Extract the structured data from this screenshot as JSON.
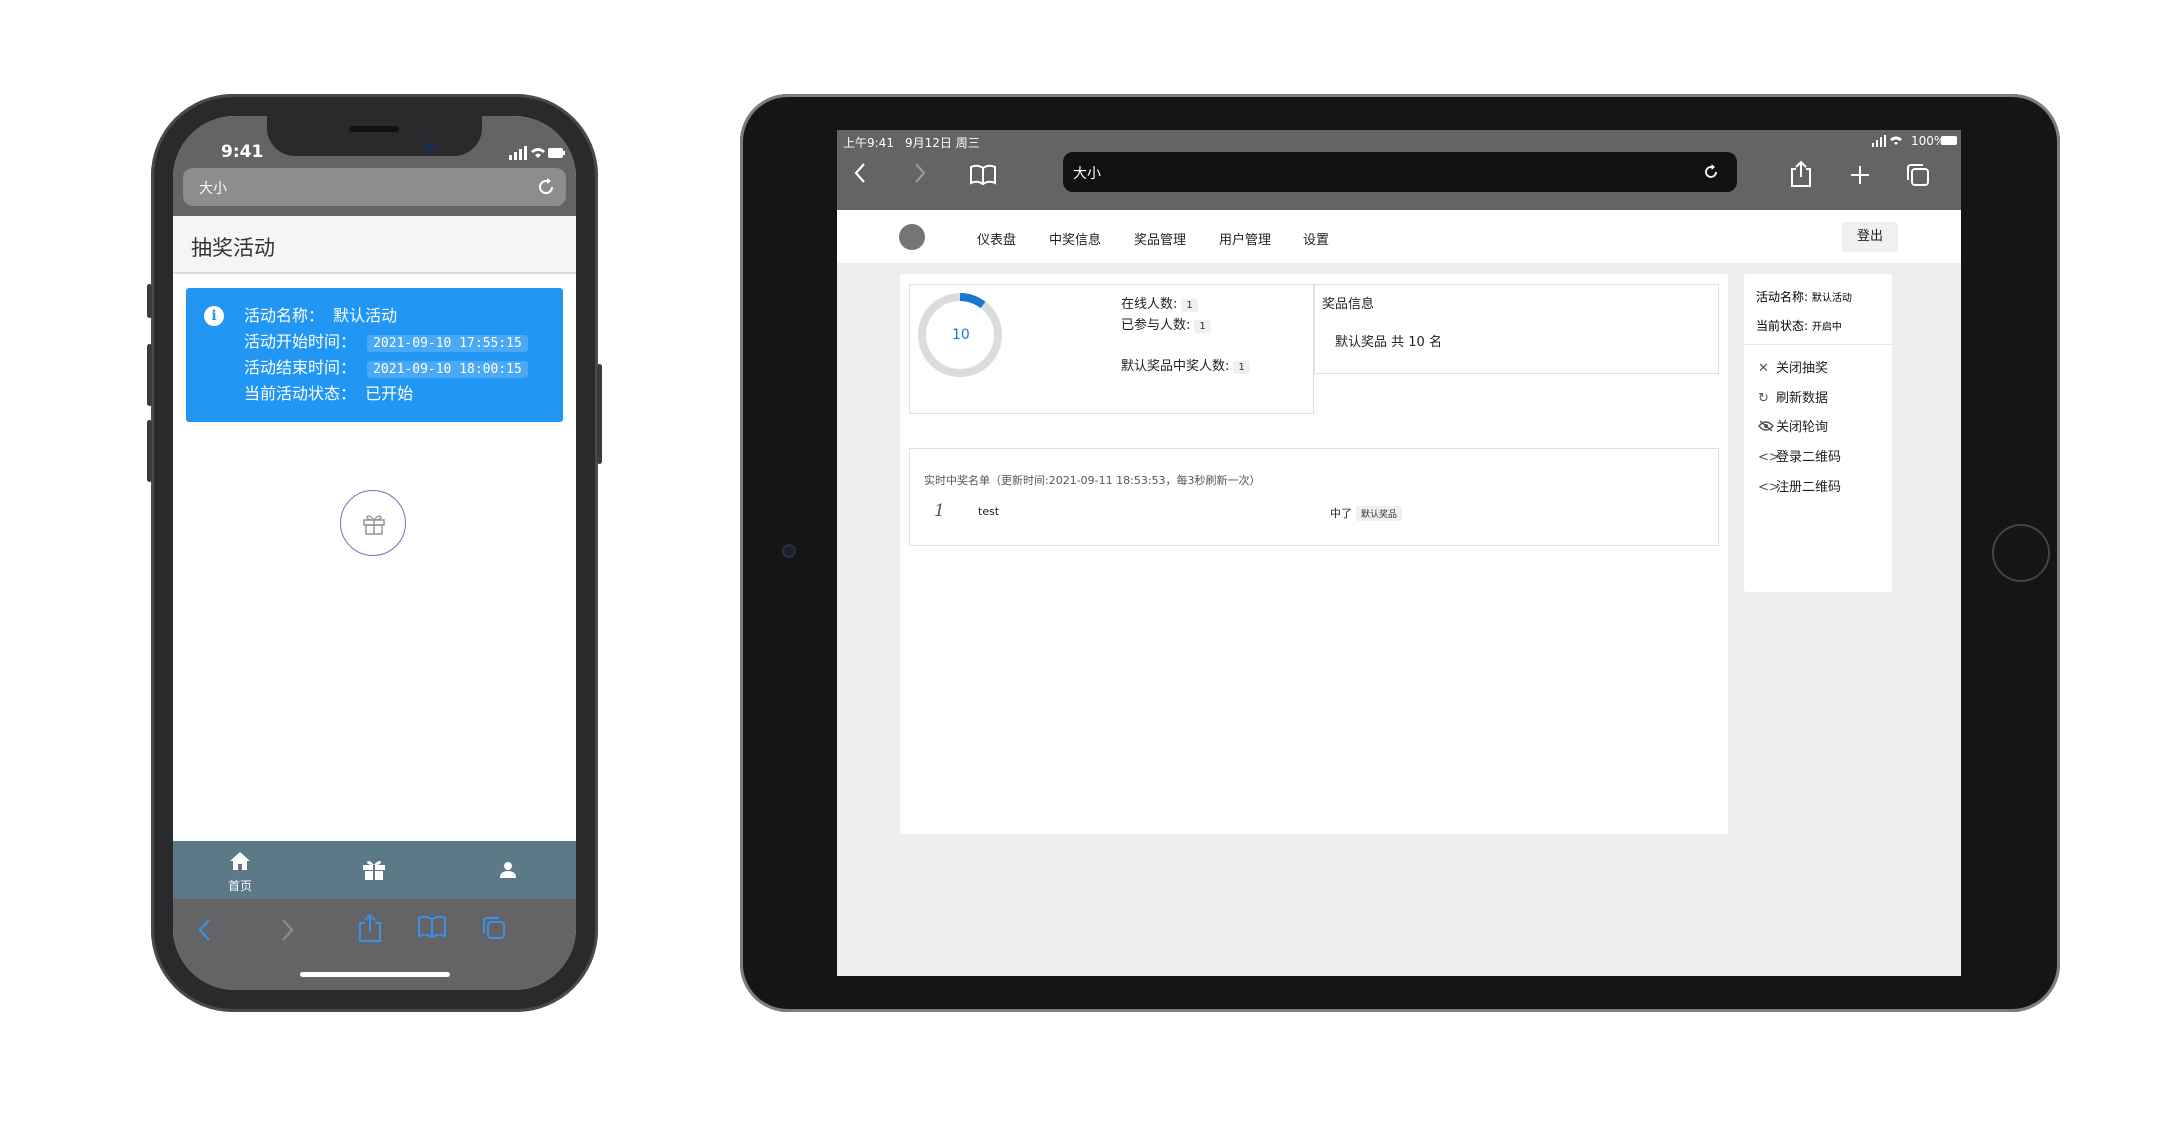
{
  "phone": {
    "status_time": "9:41",
    "url": "大小",
    "page_title": "抽奖活动",
    "info": {
      "icon": "info-icon",
      "name_label": "活动名称：",
      "name_value": "默认活动",
      "start_label": "活动开始时间：",
      "start_value": "2021-09-10 17:55:15",
      "end_label": "活动结束时间：",
      "end_value": "2021-09-10 18:00:15",
      "state_label": "当前活动状态：",
      "state_value": "已开始",
      "color": "#2196f3"
    },
    "tabs": [
      {
        "label": "首页",
        "icon": "home-icon"
      },
      {
        "label": "",
        "icon": "gift-icon"
      },
      {
        "label": "",
        "icon": "person-icon"
      }
    ],
    "tabbar_color": "#5b7987"
  },
  "tablet": {
    "status_time": "上午9:41",
    "status_date": "9月12日 周三",
    "battery": "100%",
    "url": "大小",
    "nav": [
      "仪表盘",
      "中奖信息",
      "奖品管理",
      "用户管理",
      "设置"
    ],
    "logout": "登出",
    "donut_value": "10",
    "stats": {
      "online_label": "在线人数:",
      "online_value": "1",
      "joined_label": "已参与人数:",
      "joined_value": "1",
      "winners_label": "默认奖品中奖人数:",
      "winners_value": "1"
    },
    "prize_title": "奖品信息",
    "prize_line": "默认奖品 共 10 名",
    "winners_title": "实时中奖名单（更新时间:2021-09-11 18:53:53，每3秒刷新一次）",
    "winner_row": {
      "index": "1",
      "name": "test",
      "won": "中了",
      "prize": "默认奖品"
    },
    "side": {
      "activity_label": "活动名称:",
      "activity_value": "默认活动",
      "state_label": "当前状态:",
      "state_value": "开启中",
      "actions": [
        "关闭抽奖",
        "刷新数据",
        "关闭轮询",
        "登录二维码",
        "注册二维码"
      ]
    }
  }
}
